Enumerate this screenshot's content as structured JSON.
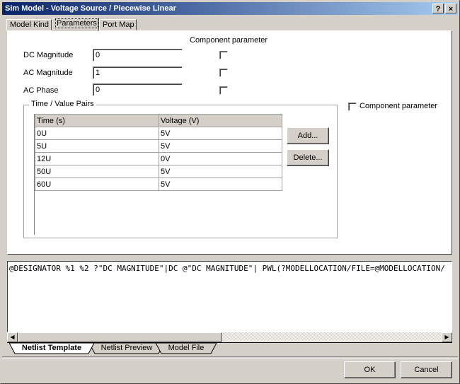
{
  "window": {
    "title": "Sim Model - Voltage Source / Piecewise Linear",
    "help_label": "?",
    "close_label": "×"
  },
  "tabs": [
    {
      "label": "Model Kind",
      "active": false
    },
    {
      "label": "Parameters",
      "active": true
    },
    {
      "label": "Port Map",
      "active": false
    }
  ],
  "parameters": {
    "component_parameter_header": "Component parameter",
    "rows": [
      {
        "label": "DC Magnitude",
        "value": "0",
        "component_parameter": false
      },
      {
        "label": "AC Magnitude",
        "value": "1",
        "component_parameter": false
      },
      {
        "label": "AC Phase",
        "value": "0",
        "component_parameter": false
      }
    ],
    "pairs_group": {
      "title": "Time / Value Pairs",
      "columns": [
        "Time (s)",
        "Voltage (V)"
      ],
      "rows": [
        [
          "0U",
          "5V"
        ],
        [
          "5U",
          "5V"
        ],
        [
          "12U",
          "0V"
        ],
        [
          "50U",
          "5V"
        ],
        [
          "60U",
          "5V"
        ]
      ],
      "add_label": "Add...",
      "delete_label": "Delete..."
    },
    "pairs_component_parameter": {
      "label": "Component parameter",
      "checked": false
    }
  },
  "netlist": {
    "text": "@DESIGNATOR %1 %2 ?\"DC MAGNITUDE\"|DC @\"DC MAGNITUDE\"| PWL(?MODELLOCATION/FILE=@MODELLOCATION/"
  },
  "bottom_tabs": [
    {
      "label": "Netlist Template",
      "active": true
    },
    {
      "label": "Netlist Preview",
      "active": false
    },
    {
      "label": "Model File",
      "active": false
    }
  ],
  "buttons": {
    "ok_label": "OK",
    "cancel_label": "Cancel"
  }
}
